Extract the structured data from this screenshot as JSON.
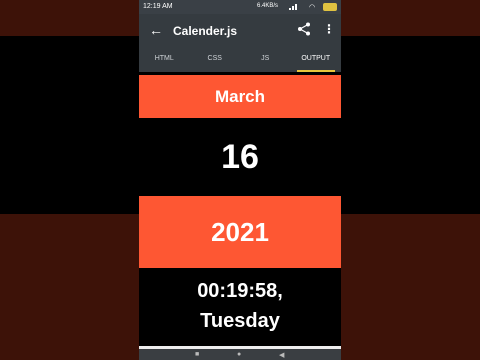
{
  "status_bar": {
    "time": "12:19 AM",
    "network_speed": "6.4KB/s"
  },
  "app_bar": {
    "title": "Calender.js"
  },
  "tabs": [
    {
      "label": "HTML"
    },
    {
      "label": "CSS"
    },
    {
      "label": "JS"
    },
    {
      "label": "OUTPUT",
      "active": true
    }
  ],
  "output": {
    "month": "March",
    "day": "16",
    "year": "2021",
    "time": "00:19:58,",
    "weekday": "Tuesday"
  },
  "colors": {
    "accent": "#fe5733",
    "tab_indicator": "#e8c53c",
    "app_bar": "#353b40"
  }
}
